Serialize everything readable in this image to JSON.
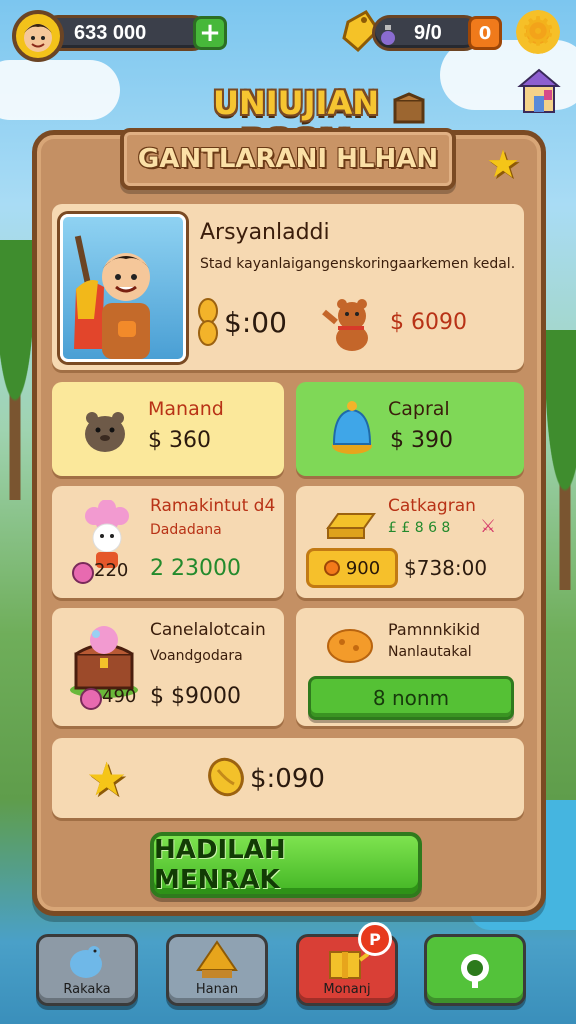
{
  "hud": {
    "coins": "633 000",
    "plus_label": "+",
    "energy": "9/0",
    "orange_label": "0"
  },
  "game_title": "UNIUJIAN BOOM",
  "header": {
    "title": "GANTLARANI HLHAN"
  },
  "hero": {
    "name": "Arsyanladdi",
    "description": "Stad kayanlaigangenskoringaarkemen kedal.",
    "price_left": "$:00",
    "price_right": "$ 6090"
  },
  "cards": [
    {
      "title": "Manand",
      "price": "$ 360",
      "color": "#fbe89b"
    },
    {
      "title": "Capral",
      "price": "$ 390",
      "color": "#7fd857"
    },
    {
      "title": "Ramakintut d4",
      "subtitle": "Dadadana",
      "badge": "220",
      "price": "2 23000"
    },
    {
      "title": "Catkagran",
      "subtitle": "£ £ 8 6 8",
      "pill": "900",
      "price": "$738:00"
    },
    {
      "title": "Canelalotcain",
      "subtitle": "Voandgodara",
      "badge": "490",
      "price": "$ $9000"
    },
    {
      "title": "Pamnnkikid",
      "subtitle": "Nanlautakal",
      "button": "8 nonm"
    }
  ],
  "summary": {
    "price": "$:090"
  },
  "claim_button": "HADILAH MENRAK",
  "nav": [
    {
      "label": "Rakaka",
      "color": "#8d9aa6"
    },
    {
      "label": "Hanan",
      "color": "#8fa2b2"
    },
    {
      "label": "Monanj",
      "color": "#d93f36",
      "badge": "P"
    },
    {
      "label": "",
      "color": "#53c23a"
    }
  ]
}
